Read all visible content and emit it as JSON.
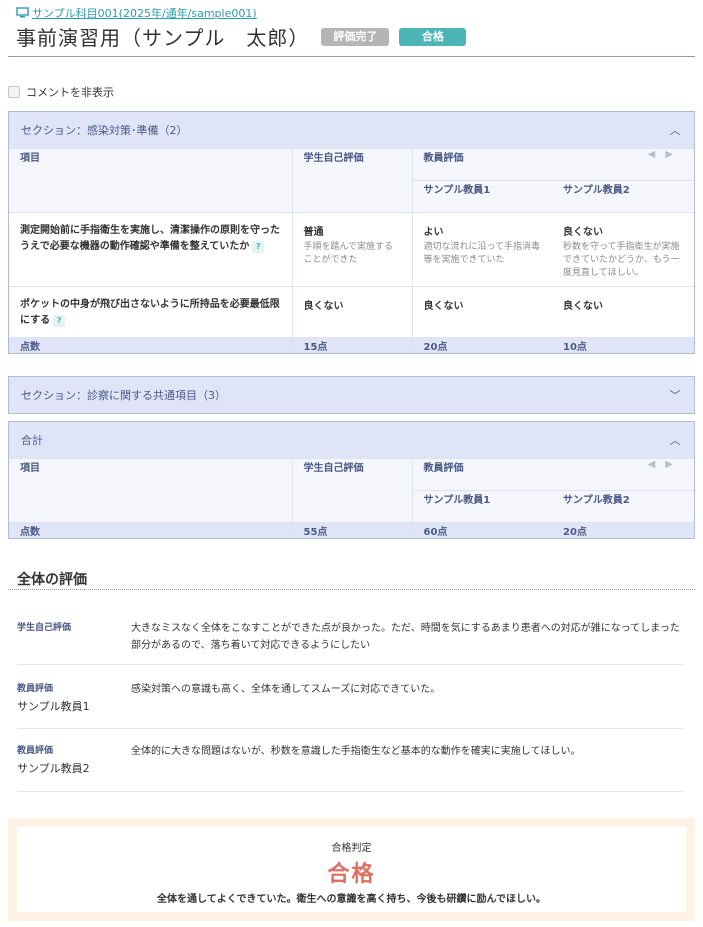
{
  "breadcrumb": {
    "icon": "monitor-icon",
    "text": "サンプル科目001(2025年/通年/sample001)"
  },
  "header": {
    "title": "事前演習用（サンプル　太郎）",
    "status_badge": "評価完了",
    "result_badge": "合格"
  },
  "toggle": {
    "label": "コメントを非表示"
  },
  "section1": {
    "title": "セクション：感染対策･準備（2）",
    "col_item": "項目",
    "col_self": "学生自己評価",
    "col_teacher": "教員評価",
    "teacher1": "サンプル教員1",
    "teacher2": "サンプル教員2",
    "rows": [
      {
        "item": "測定開始前に手指衛生を実施し、清潔操作の原則を守ったうえで必要な機器の動作確認や準備を整えていたか",
        "self_value": "普通",
        "self_note": "手順を踏んで実施することができた",
        "t1_value": "よい",
        "t1_note": "適切な流れに沿って手指消毒等を実施できていた",
        "t2_value": "良くない",
        "t2_note": "秒数を守って手指衛生が実施できていたかどうか、もう一度見直してほしい。"
      },
      {
        "item": "ポケットの中身が飛び出さないように所持品を必要最低限にする",
        "self_value": "良くない",
        "t1_value": "良くない",
        "t2_value": "良くない"
      }
    ],
    "score_label": "点数",
    "score_self": "15点",
    "score_t1": "20点",
    "score_t2": "10点"
  },
  "section2": {
    "title": "セクション：診察に関する共通項目（3）"
  },
  "total": {
    "title": "合計",
    "col_item": "項目",
    "col_self": "学生自己評価",
    "col_teacher": "教員評価",
    "teacher1": "サンプル教員1",
    "teacher2": "サンプル教員2",
    "score_label": "点数",
    "score_self": "55点",
    "score_t1": "60点",
    "score_t2": "20点"
  },
  "overall": {
    "title": "全体の評価",
    "self_tag": "学生自己評価",
    "self_text": "大きなミスなく全体をこなすことができた点が良かった。ただ、時間を気にするあまり患者への対応が雑になってしまった部分があるので、落ち着いて対応できるようにしたい",
    "t1_tag": "教員評価",
    "t1_name": "サンプル教員1",
    "t1_text": "感染対策への意識も高く、全体を通してスムーズに対応できていた。",
    "t2_tag": "教員評価",
    "t2_name": "サンプル教員2",
    "t2_text": "全体的に大きな問題はないが、秒数を意識した手指衛生など基本的な動作を確実に実施してほしい。"
  },
  "verdict": {
    "label": "合格判定",
    "result": "合格",
    "comment": "全体を通してよくできていた。衛生への意識を高く持ち、今後も研鑽に励んでほしい。"
  }
}
